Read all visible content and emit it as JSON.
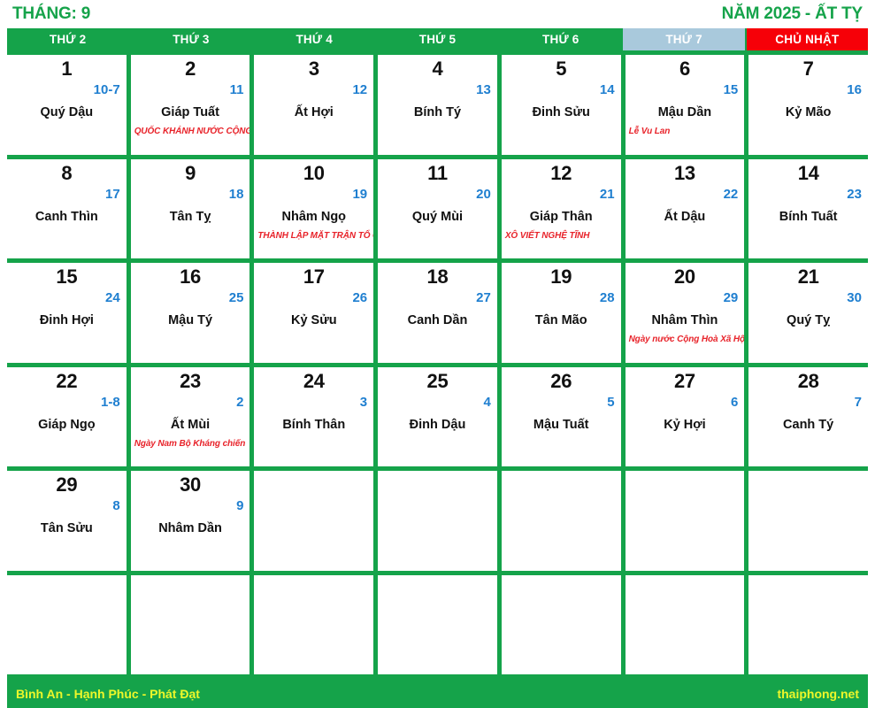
{
  "header": {
    "month_label": "THÁNG: 9",
    "year_label": "NĂM 2025 - ẤT TỴ"
  },
  "weekdays": [
    {
      "label": "THỨ 2",
      "kind": "weekday"
    },
    {
      "label": "THỨ 3",
      "kind": "weekday"
    },
    {
      "label": "THỨ 4",
      "kind": "weekday"
    },
    {
      "label": "THỨ 5",
      "kind": "weekday"
    },
    {
      "label": "THỨ 6",
      "kind": "weekday"
    },
    {
      "label": "THỨ 7",
      "kind": "saturday"
    },
    {
      "label": "CHỦ NHẬT",
      "kind": "sunday"
    }
  ],
  "colors": {
    "brand_green": "#15a34a",
    "sunday_red": "#f60008",
    "saturday_blue": "#a9c9dc",
    "lunar_blue": "#1f7fd0",
    "event_red": "#e8232a",
    "footer_yellow": "#edf72a"
  },
  "days": [
    {
      "solar": "1",
      "lunar": "10-7",
      "canchi": "Quý Dậu",
      "note": ""
    },
    {
      "solar": "2",
      "lunar": "11",
      "canchi": "Giáp Tuất",
      "note": "QUỐC KHÁNH NƯỚC CỘNG HOÀ"
    },
    {
      "solar": "3",
      "lunar": "12",
      "canchi": "Ất Hợi",
      "note": ""
    },
    {
      "solar": "4",
      "lunar": "13",
      "canchi": "Bính Tý",
      "note": ""
    },
    {
      "solar": "5",
      "lunar": "14",
      "canchi": "Đinh Sửu",
      "note": ""
    },
    {
      "solar": "6",
      "lunar": "15",
      "canchi": "Mậu Dần",
      "note": "Lễ Vu Lan"
    },
    {
      "solar": "7",
      "lunar": "16",
      "canchi": "Kỷ Mão",
      "note": ""
    },
    {
      "solar": "8",
      "lunar": "17",
      "canchi": "Canh Thìn",
      "note": ""
    },
    {
      "solar": "9",
      "lunar": "18",
      "canchi": "Tân Tỵ",
      "note": ""
    },
    {
      "solar": "10",
      "lunar": "19",
      "canchi": "Nhâm Ngọ",
      "note": "THÀNH LẬP MẶT TRẬN TỔ QUỐC"
    },
    {
      "solar": "11",
      "lunar": "20",
      "canchi": "Quý Mùi",
      "note": ""
    },
    {
      "solar": "12",
      "lunar": "21",
      "canchi": "Giáp Thân",
      "note": "XÔ VIẾT NGHỆ TĨNH"
    },
    {
      "solar": "13",
      "lunar": "22",
      "canchi": "Ất Dậu",
      "note": ""
    },
    {
      "solar": "14",
      "lunar": "23",
      "canchi": "Bính Tuất",
      "note": ""
    },
    {
      "solar": "15",
      "lunar": "24",
      "canchi": "Đinh Hợi",
      "note": ""
    },
    {
      "solar": "16",
      "lunar": "25",
      "canchi": "Mậu Tý",
      "note": ""
    },
    {
      "solar": "17",
      "lunar": "26",
      "canchi": "Kỷ Sửu",
      "note": ""
    },
    {
      "solar": "18",
      "lunar": "27",
      "canchi": "Canh Dần",
      "note": ""
    },
    {
      "solar": "19",
      "lunar": "28",
      "canchi": "Tân Mão",
      "note": ""
    },
    {
      "solar": "20",
      "lunar": "29",
      "canchi": "Nhâm Thìn",
      "note": "Ngày nước Cộng Hoà Xã Hội"
    },
    {
      "solar": "21",
      "lunar": "30",
      "canchi": "Quý Tỵ",
      "note": ""
    },
    {
      "solar": "22",
      "lunar": "1-8",
      "canchi": "Giáp Ngọ",
      "note": ""
    },
    {
      "solar": "23",
      "lunar": "2",
      "canchi": "Ất Mùi",
      "note": "Ngày Nam Bộ Kháng chiến"
    },
    {
      "solar": "24",
      "lunar": "3",
      "canchi": "Bính Thân",
      "note": ""
    },
    {
      "solar": "25",
      "lunar": "4",
      "canchi": "Đinh Dậu",
      "note": ""
    },
    {
      "solar": "26",
      "lunar": "5",
      "canchi": "Mậu Tuất",
      "note": ""
    },
    {
      "solar": "27",
      "lunar": "6",
      "canchi": "Kỷ Hợi",
      "note": ""
    },
    {
      "solar": "28",
      "lunar": "7",
      "canchi": "Canh Tý",
      "note": ""
    },
    {
      "solar": "29",
      "lunar": "8",
      "canchi": "Tân Sửu",
      "note": ""
    },
    {
      "solar": "30",
      "lunar": "9",
      "canchi": "Nhâm Dần",
      "note": ""
    },
    {
      "solar": "",
      "lunar": "",
      "canchi": "",
      "note": ""
    },
    {
      "solar": "",
      "lunar": "",
      "canchi": "",
      "note": ""
    },
    {
      "solar": "",
      "lunar": "",
      "canchi": "",
      "note": ""
    },
    {
      "solar": "",
      "lunar": "",
      "canchi": "",
      "note": ""
    },
    {
      "solar": "",
      "lunar": "",
      "canchi": "",
      "note": ""
    },
    {
      "solar": "",
      "lunar": "",
      "canchi": "",
      "note": ""
    },
    {
      "solar": "",
      "lunar": "",
      "canchi": "",
      "note": ""
    },
    {
      "solar": "",
      "lunar": "",
      "canchi": "",
      "note": ""
    },
    {
      "solar": "",
      "lunar": "",
      "canchi": "",
      "note": ""
    },
    {
      "solar": "",
      "lunar": "",
      "canchi": "",
      "note": ""
    },
    {
      "solar": "",
      "lunar": "",
      "canchi": "",
      "note": ""
    },
    {
      "solar": "",
      "lunar": "",
      "canchi": "",
      "note": ""
    }
  ],
  "footer": {
    "left_text": "Bình An - Hạnh Phúc - Phát Đạt",
    "right_text": "thaiphong.net"
  }
}
